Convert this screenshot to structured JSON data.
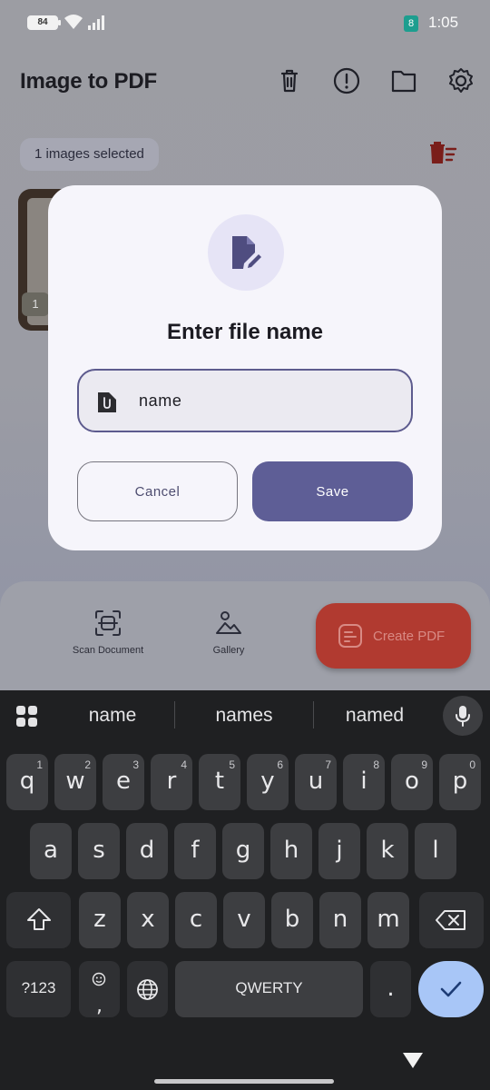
{
  "status_bar": {
    "battery": "84",
    "time": "1:05",
    "app_indicator": "8"
  },
  "app": {
    "title": "Image to PDF",
    "selection_chip": "1 images selected",
    "thumbnail_index": "1",
    "toolbar_icons": [
      "trash-icon",
      "info-icon",
      "folder-icon",
      "gear-icon"
    ],
    "actions": {
      "scan": "Scan Document",
      "gallery": "Gallery",
      "create": "Create PDF"
    }
  },
  "dialog": {
    "title": "Enter file name",
    "field_value": "name",
    "cancel_label": "Cancel",
    "save_label": "Save",
    "accent": "#5e5e96"
  },
  "keyboard": {
    "suggestions": [
      "name",
      "names",
      "named"
    ],
    "row1": [
      {
        "k": "q",
        "h": "1"
      },
      {
        "k": "w",
        "h": "2"
      },
      {
        "k": "e",
        "h": "3"
      },
      {
        "k": "r",
        "h": "4"
      },
      {
        "k": "t",
        "h": "5"
      },
      {
        "k": "y",
        "h": "6"
      },
      {
        "k": "u",
        "h": "7"
      },
      {
        "k": "i",
        "h": "8"
      },
      {
        "k": "o",
        "h": "9"
      },
      {
        "k": "p",
        "h": "0"
      }
    ],
    "row2": [
      "a",
      "s",
      "d",
      "f",
      "g",
      "h",
      "j",
      "k",
      "l"
    ],
    "row3": [
      "z",
      "x",
      "c",
      "v",
      "b",
      "n",
      "m"
    ],
    "symbols_label": "?123",
    "comma_label": ",",
    "space_label": "QWERTY",
    "period_label": "."
  }
}
